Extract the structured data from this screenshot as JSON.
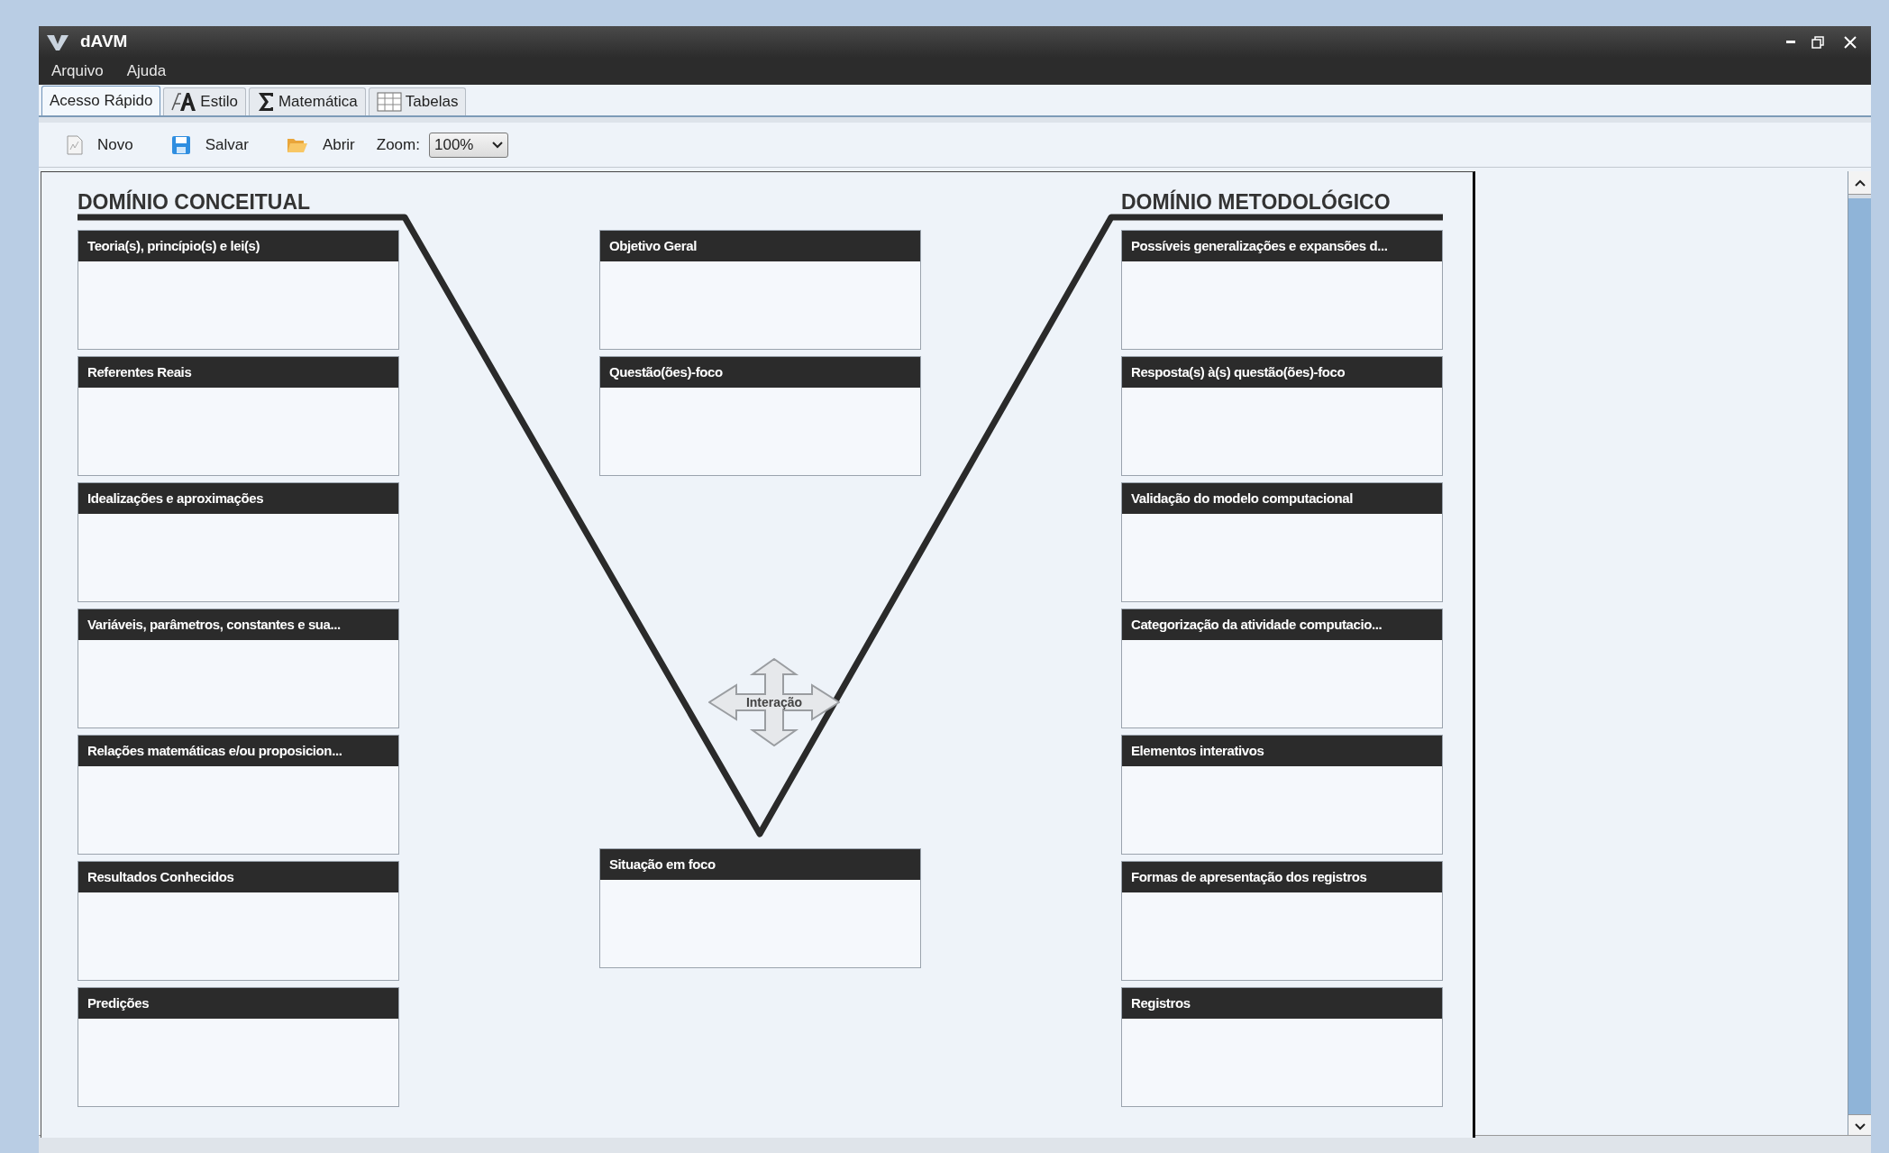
{
  "window": {
    "title": "dAVM"
  },
  "menu": [
    "Arquivo",
    "Ajuda"
  ],
  "tabs": [
    {
      "label": "Acesso Rápido",
      "kind": "plain",
      "selected": true
    },
    {
      "label": "Estilo",
      "kind": "style",
      "selected": false
    },
    {
      "label": "Matemática",
      "kind": "sigma",
      "selected": false
    },
    {
      "label": "Tabelas",
      "kind": "table",
      "selected": false
    }
  ],
  "toolbar": {
    "buttons": [
      {
        "label": "Novo",
        "kind": "new"
      },
      {
        "label": "Salvar",
        "kind": "save"
      },
      {
        "label": "Abrir",
        "kind": "open"
      }
    ],
    "zoom_label": "Zoom:",
    "zoom_value": "100%"
  },
  "diagram": {
    "left_heading": "DOMÍNIO CONCEITUAL",
    "right_heading": "DOMÍNIO METODOLÓGICO",
    "center_label": "Interação",
    "left_boxes": [
      "Teoria(s), princípio(s) e lei(s)",
      "Referentes Reais",
      "Idealizações e aproximações",
      "Variáveis, parâmetros, constantes e sua...",
      "Relações matemáticas e/ou proposicion...",
      "Resultados Conhecidos",
      "Predições"
    ],
    "middle_top_boxes": [
      "Objetivo Geral",
      "Questão(ões)-foco"
    ],
    "middle_bottom_box": "Situação em foco",
    "right_boxes": [
      "Possíveis generalizações e expansões d...",
      "Resposta(s) à(s) questão(ões)-foco",
      "Validação do modelo computacional",
      "Categorização da atividade computacio...",
      "Elementos interativos",
      "Formas de apresentação dos registros",
      "Registros"
    ]
  }
}
